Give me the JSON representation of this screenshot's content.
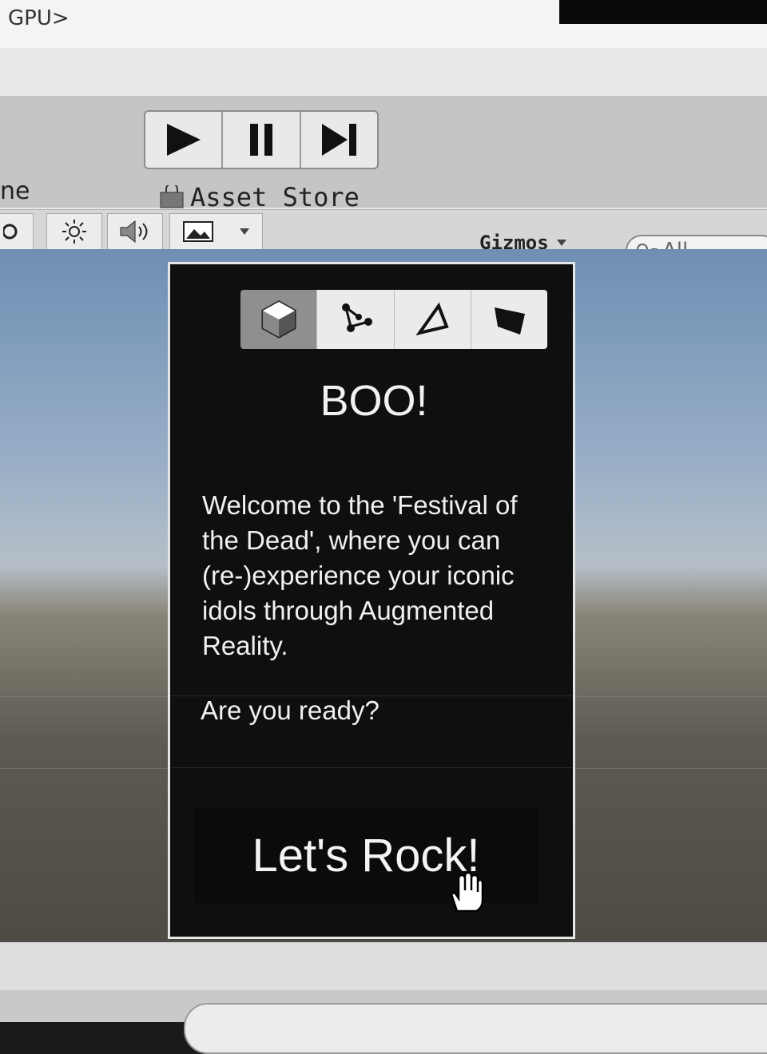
{
  "top": {
    "prompt": "GPU>"
  },
  "editor": {
    "tab_partial": "ne",
    "asset_store": "Asset Store",
    "gizmos": "Gizmos",
    "search_placeholder": "All",
    "search_icon": "search-icon"
  },
  "playback": [
    {
      "name": "play-button",
      "icon": "play-icon"
    },
    {
      "name": "pause-button",
      "icon": "pause-icon"
    },
    {
      "name": "step-button",
      "icon": "step-icon"
    }
  ],
  "panel": {
    "title": "BOO!",
    "body": "Welcome to the 'Festival of the Dead', where you can (re-)experience your iconic idols through Augmented Reality.",
    "question": "Are you ready?",
    "button_label": "Let's Rock!"
  },
  "colors": {
    "panel_bg": "#0d100f",
    "panel_border": "#e6e6e6",
    "text": "#f0f0f0"
  }
}
